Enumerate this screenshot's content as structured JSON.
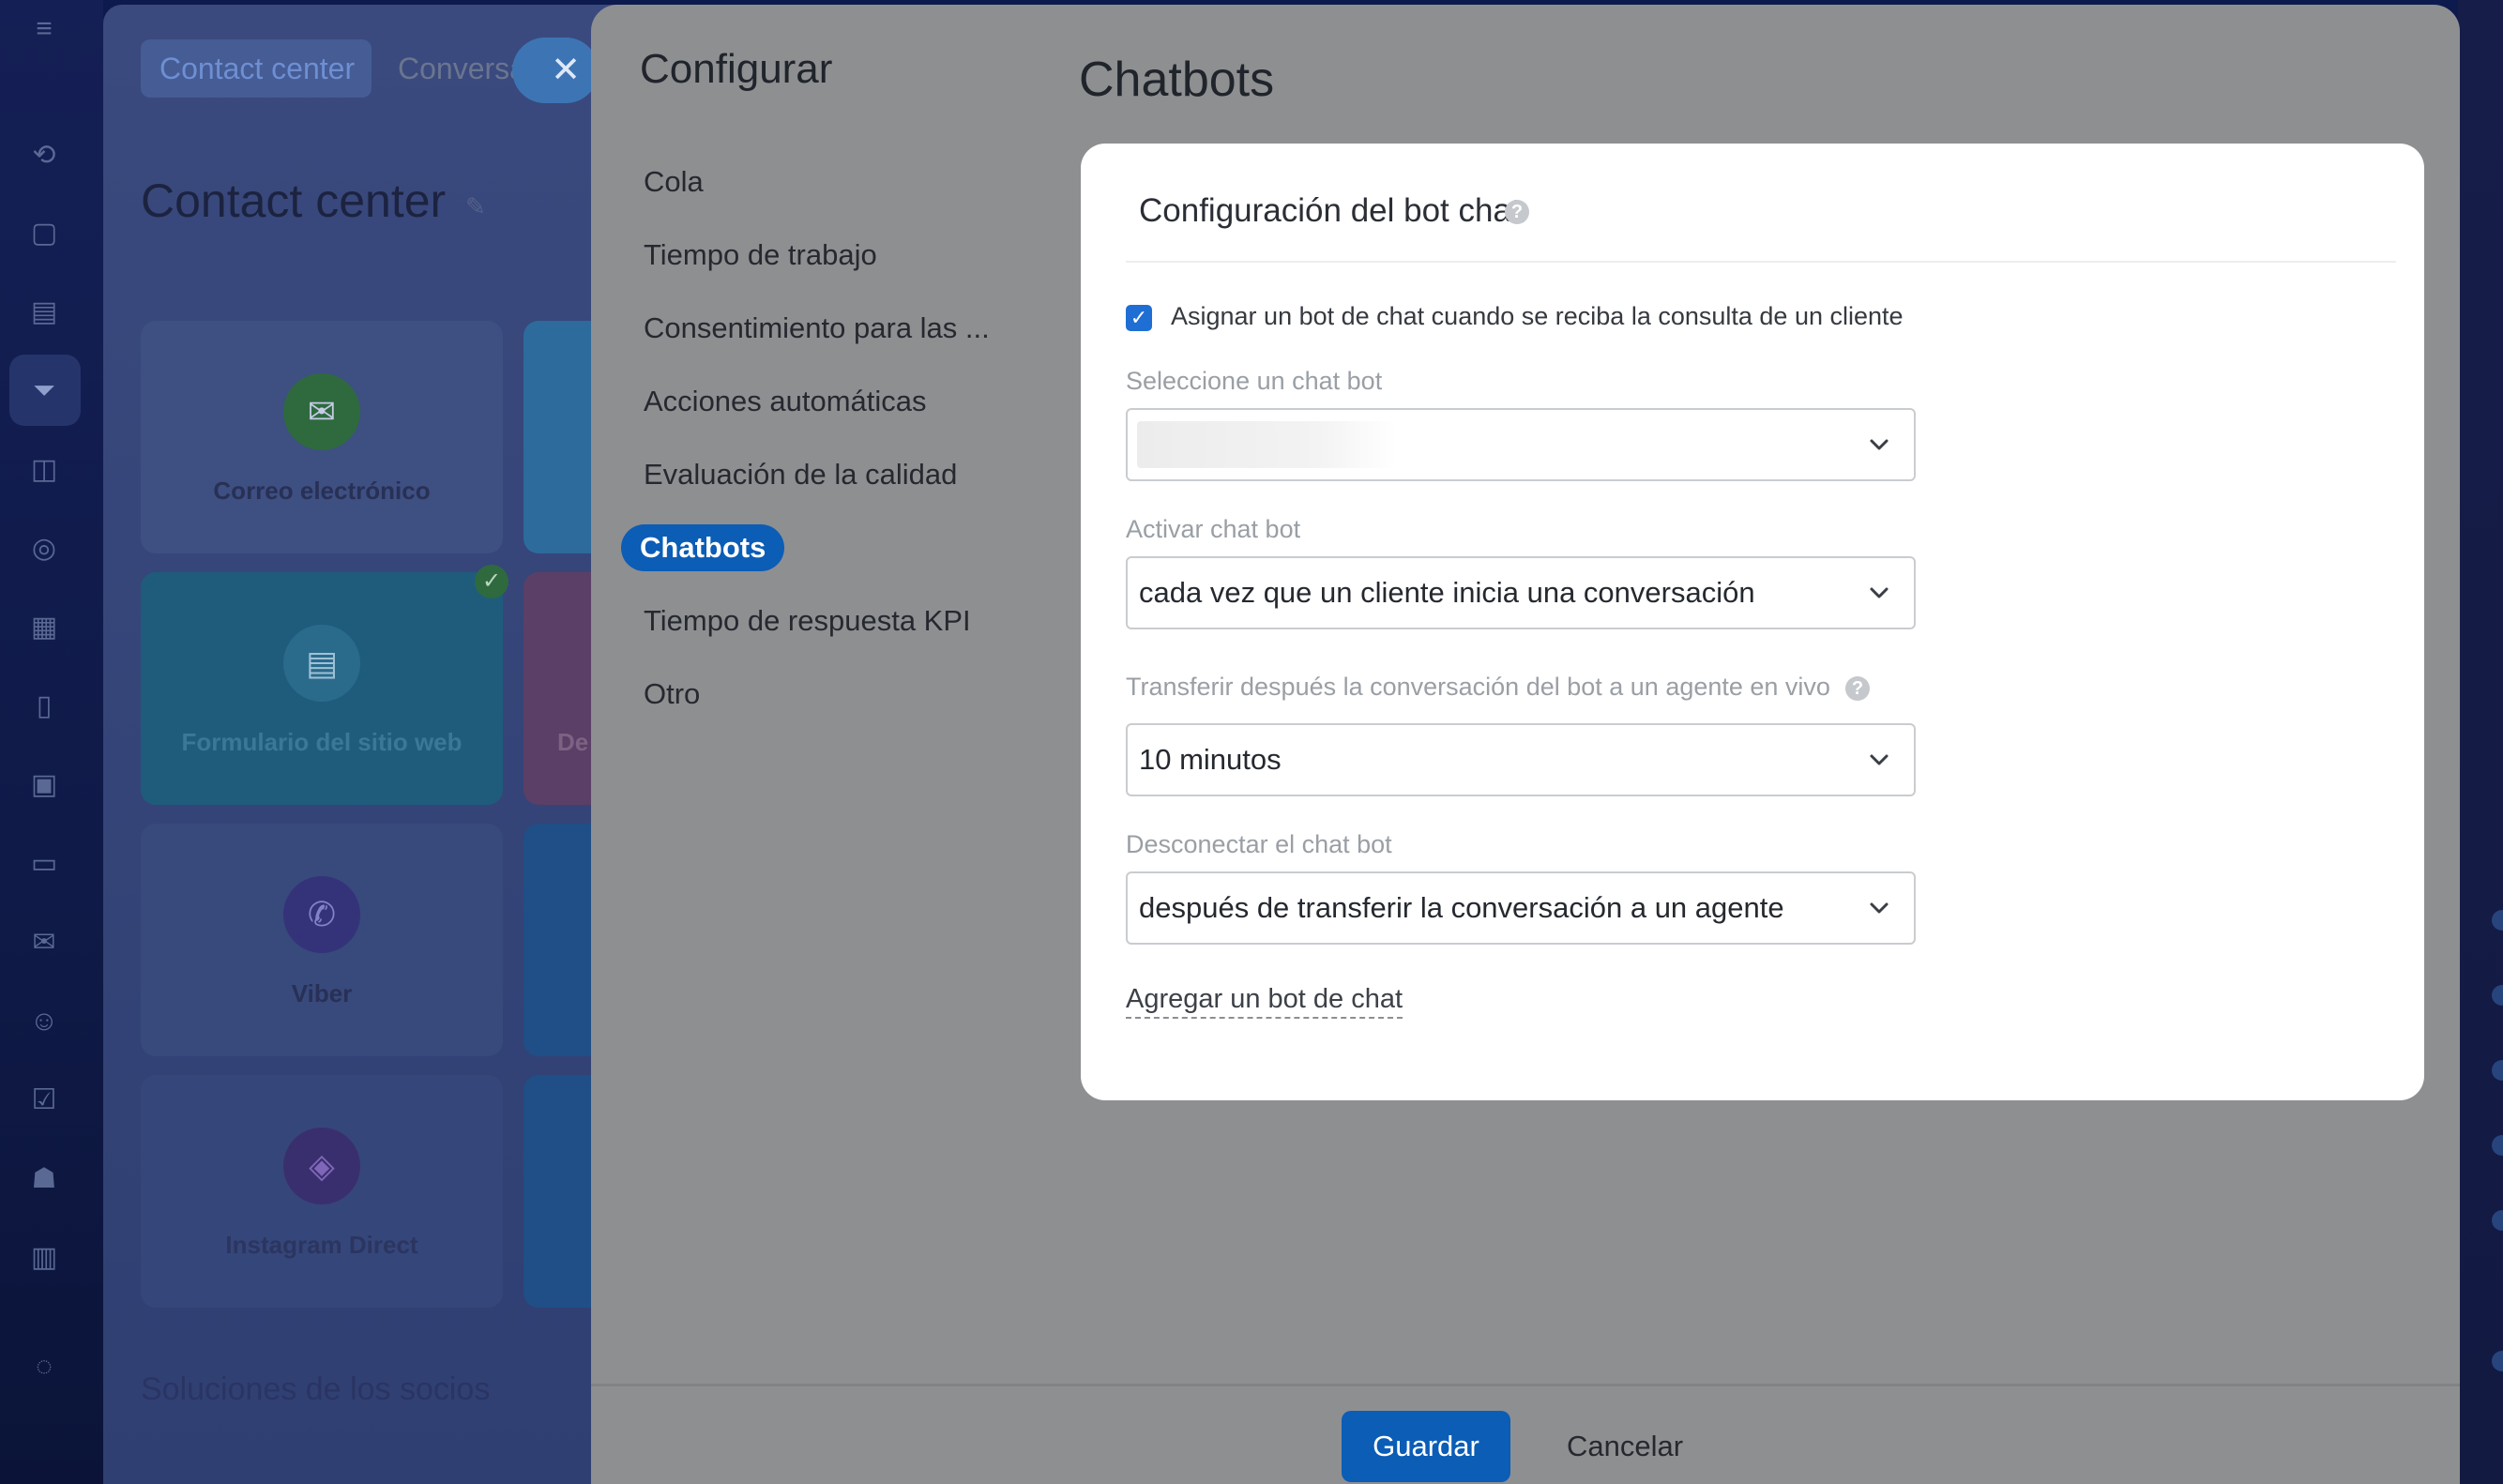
{
  "background_app": {
    "tabs": [
      {
        "label": "Contact center",
        "active": true
      },
      {
        "label": "Conversa",
        "active": false
      }
    ],
    "heading": "Contact center",
    "tiles": [
      {
        "label": "Correo electrónico",
        "icon": "mail-icon"
      },
      {
        "label": "Formulario del sitio web",
        "icon": "form-icon",
        "connected": true
      },
      {
        "label": "Viber",
        "icon": "viber-icon"
      },
      {
        "label": "Instagram Direct",
        "icon": "instagram-icon"
      }
    ],
    "partial_tile_label": "De",
    "footer_text": "Soluciones de los socios"
  },
  "settings": {
    "title": "Configurar",
    "menu": [
      {
        "label": "Cola",
        "active": false
      },
      {
        "label": "Tiempo de trabajo",
        "active": false
      },
      {
        "label": "Consentimiento para las ...",
        "active": false
      },
      {
        "label": "Acciones automáticas",
        "active": false
      },
      {
        "label": "Evaluación de la calidad",
        "active": false
      },
      {
        "label": "Chatbots",
        "active": true
      },
      {
        "label": "Tiempo de respuesta KPI",
        "active": false
      },
      {
        "label": "Otro",
        "active": false
      }
    ],
    "content_title": "Chatbots",
    "card": {
      "title": "Configuración del bot chat",
      "assign_checkbox": {
        "checked": true,
        "label": "Asignar un bot de chat cuando se reciba la consulta de un cliente"
      },
      "select_bot": {
        "label": "Seleccione un chat bot",
        "value": ""
      },
      "activate": {
        "label": "Activar chat bot",
        "value": "cada vez que un cliente inicia una conversación"
      },
      "transfer": {
        "label": "Transferir después la conversación del bot a un agente en vivo",
        "value": "10 minutos"
      },
      "disconnect": {
        "label": "Desconectar el chat bot",
        "value": "después de transferir la conversación a un agente"
      },
      "add_link": "Agregar un bot de chat"
    },
    "footer": {
      "save_label": "Guardar",
      "cancel_label": "Cancelar"
    }
  },
  "colors": {
    "accent": "#0b5db6",
    "checkbox": "#1f6ed4",
    "overlay": "#8e8f91",
    "rail": "#0f1a48"
  }
}
